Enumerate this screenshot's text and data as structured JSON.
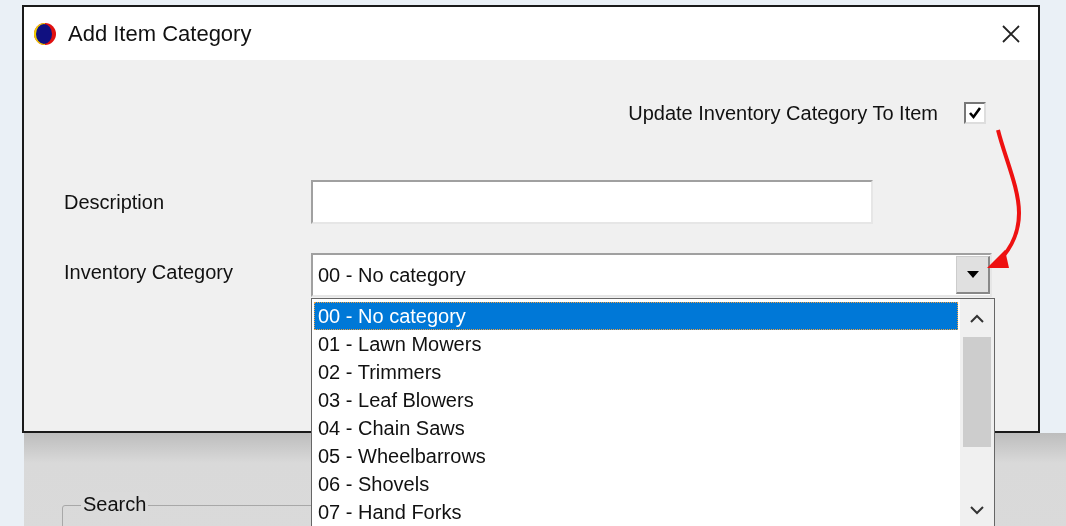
{
  "window": {
    "title": "Add Item Category"
  },
  "update_checkbox": {
    "label": "Update Inventory Category To Item",
    "checked": true
  },
  "description": {
    "label": "Description"
  },
  "inventory_category": {
    "label": "Inventory Category",
    "value": "00 - No category",
    "expanded": true,
    "options": [
      {
        "text": "00 - No category",
        "selected": true
      },
      {
        "text": "01 - Lawn Mowers",
        "selected": false
      },
      {
        "text": "02 - Trimmers",
        "selected": false
      },
      {
        "text": "03 - Leaf Blowers",
        "selected": false
      },
      {
        "text": "04 - Chain Saws",
        "selected": false
      },
      {
        "text": "05 - Wheelbarrows",
        "selected": false
      },
      {
        "text": "06 - Shovels",
        "selected": false
      },
      {
        "text": "07 - Hand Forks",
        "selected": false
      }
    ]
  },
  "background_window": {
    "group_label": "Search"
  }
}
